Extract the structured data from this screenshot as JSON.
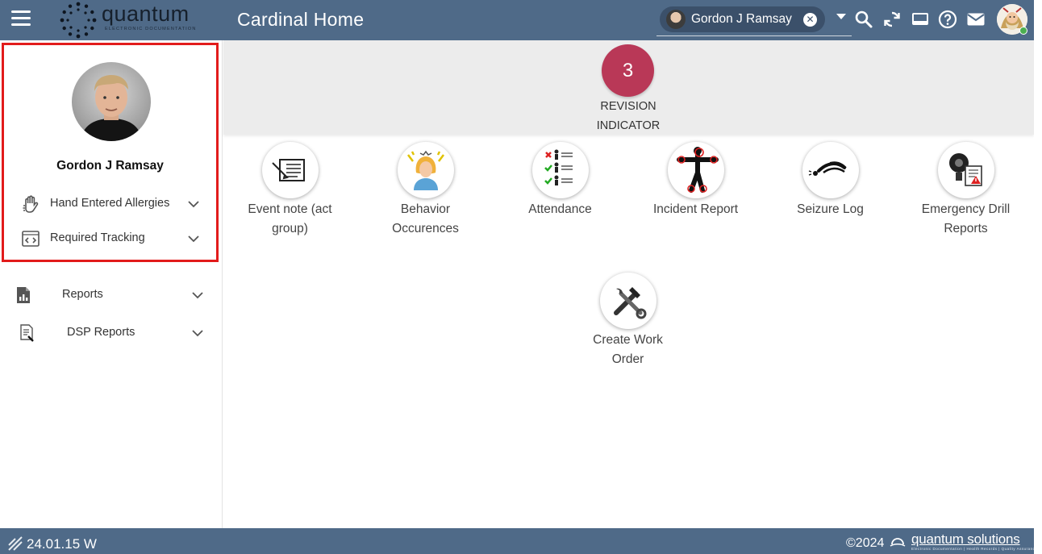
{
  "header": {
    "logo_word": "quantum",
    "logo_sub": "ELECTRONIC DOCUMENTATION",
    "title": "Cardinal Home",
    "patient_chip": {
      "name": "Gordon J Ramsay",
      "close_symbol": "✕"
    },
    "icons": [
      "search-icon",
      "refresh-icon",
      "screen-icon",
      "help-icon",
      "mail-icon"
    ]
  },
  "sidebar": {
    "profile_name": "Gordon J Ramsay",
    "profile_items": [
      {
        "label": "Hand Entered Allergies",
        "icon": "hand-icon"
      },
      {
        "label": "Required Tracking",
        "icon": "code-icon"
      }
    ],
    "nav_items": [
      {
        "label": "Reports",
        "icon": "report-icon"
      },
      {
        "label": "DSP Reports",
        "icon": "dsp-report-icon"
      }
    ]
  },
  "revision": {
    "count": "3",
    "label_line1": "REVISION",
    "label_line2": "INDICATOR"
  },
  "tiles": [
    {
      "label_line1": "Event note (act",
      "label_line2": "group)",
      "icon": "event-note-icon"
    },
    {
      "label_line1": "Behavior",
      "label_line2": "Occurences",
      "icon": "behavior-icon"
    },
    {
      "label_line1": "Attendance",
      "label_line2": "",
      "icon": "attendance-icon"
    },
    {
      "label_line1": "Incident Report",
      "label_line2": "",
      "icon": "incident-icon"
    },
    {
      "label_line1": "Seizure Log",
      "label_line2": "",
      "icon": "seizure-icon"
    },
    {
      "label_line1": "Emergency Drill",
      "label_line2": "Reports",
      "icon": "emergency-drill-icon"
    },
    {
      "label_line1": "Create Work",
      "label_line2": "Order",
      "icon": "work-order-icon"
    }
  ],
  "footer": {
    "version": "24.01.15 W",
    "copyright": "©2024",
    "brand": "quantum solutions",
    "brand_sub": "Electronic Documentation | Health Records | Quality Assurance"
  },
  "colors": {
    "bar": "#4f6a88",
    "revision": "#b93857",
    "highlight_border": "#e21b1b"
  }
}
